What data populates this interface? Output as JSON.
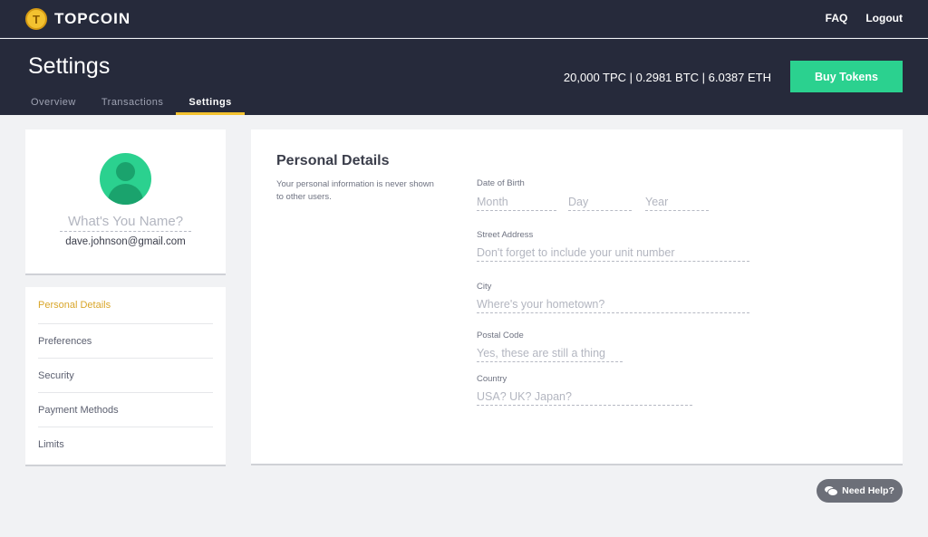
{
  "brand": {
    "name": "TOPCOIN",
    "logo_glyph": "T"
  },
  "topnav": {
    "faq": "FAQ",
    "logout": "Logout"
  },
  "header": {
    "title": "Settings",
    "tabs": [
      {
        "label": "Overview"
      },
      {
        "label": "Transactions"
      },
      {
        "label": "Settings"
      }
    ],
    "balance": "20,000 TPC | 0.2981 BTC | 6.0387 ETH",
    "buy_label": "Buy Tokens"
  },
  "profile": {
    "name_placeholder": "What's You Name?",
    "email": "dave.johnson@gmail.com"
  },
  "side_menu": {
    "items": [
      {
        "label": "Personal Details"
      },
      {
        "label": "Preferences"
      },
      {
        "label": "Security"
      },
      {
        "label": "Payment Methods"
      },
      {
        "label": "Limits"
      }
    ]
  },
  "personal_details": {
    "title": "Personal Details",
    "description": "Your personal information is never shown to other users.",
    "dob": {
      "label": "Date of Birth",
      "month_placeholder": "Month",
      "day_placeholder": "Day",
      "year_placeholder": "Year"
    },
    "street": {
      "label": "Street Address",
      "placeholder": "Don't forget to include your unit number"
    },
    "city": {
      "label": "City",
      "placeholder": "Where's your hometown?"
    },
    "postal": {
      "label": "Postal Code",
      "placeholder": "Yes, these are still a thing"
    },
    "country": {
      "label": "Country",
      "placeholder": "USA? UK? Japan?"
    }
  },
  "help": {
    "label": "Need Help?"
  },
  "colors": {
    "nav_bg": "#262a3b",
    "accent_green": "#2bd18f",
    "accent_gold": "#f3c230",
    "active_menu": "#d9a62a",
    "page_bg": "#f1f2f4"
  }
}
